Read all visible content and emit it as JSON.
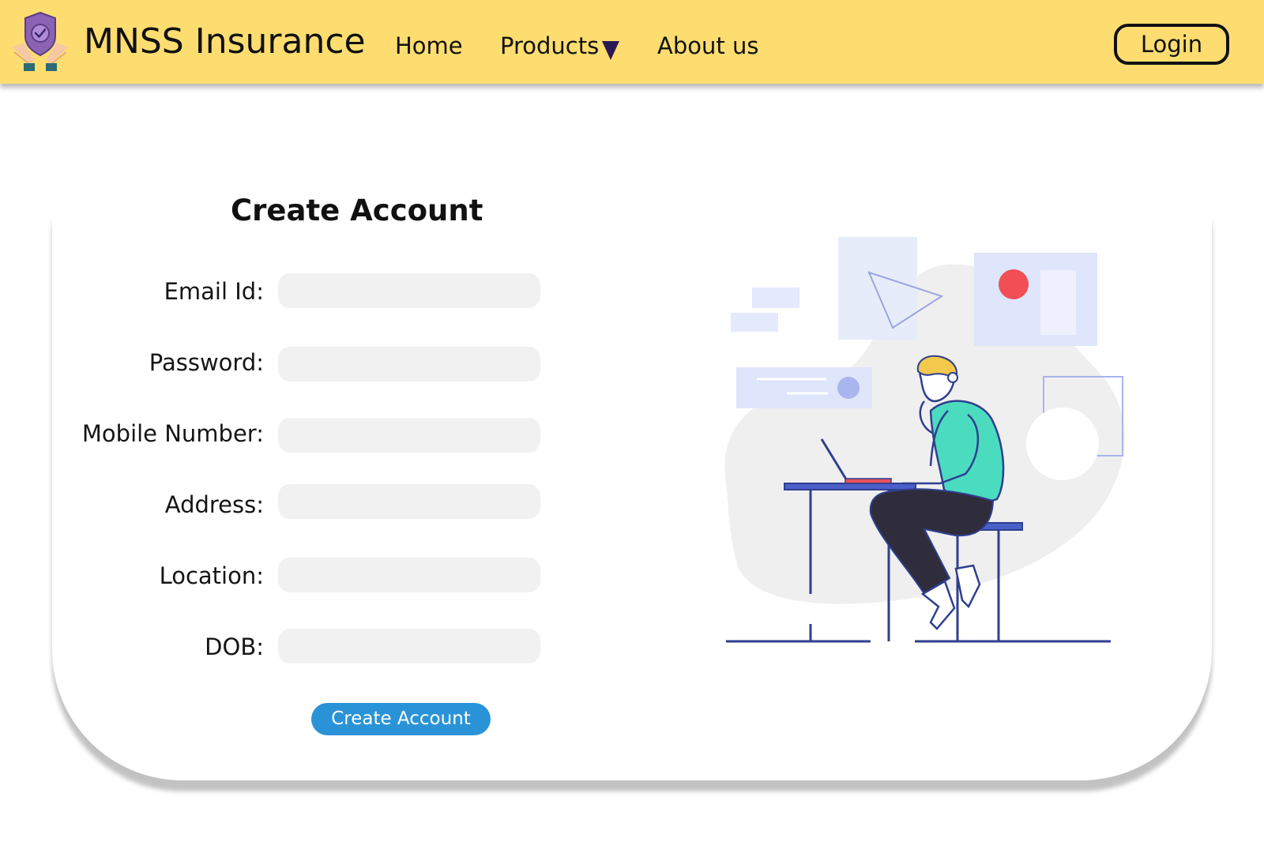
{
  "header": {
    "brand": "MNSS Insurance",
    "logo_icon": "shield-check-hands-icon",
    "nav": {
      "home": "Home",
      "products": "Products",
      "about": "About us"
    },
    "products_dropdown_icon": "caret-down-icon",
    "login_label": "Login",
    "background_color": "#fddd70"
  },
  "form": {
    "title": "Create Account",
    "fields": {
      "email": {
        "label": "Email Id:",
        "value": ""
      },
      "password": {
        "label": "Password:",
        "value": ""
      },
      "mobile": {
        "label": "Mobile Number:",
        "value": ""
      },
      "address": {
        "label": "Address:",
        "value": ""
      },
      "location": {
        "label": "Location:",
        "value": ""
      },
      "dob": {
        "label": "DOB:",
        "value": ""
      }
    },
    "submit_label": "Create Account",
    "submit_color": "#2a93d8"
  },
  "illustration": {
    "icon": "person-working-on-laptop-illustration"
  }
}
